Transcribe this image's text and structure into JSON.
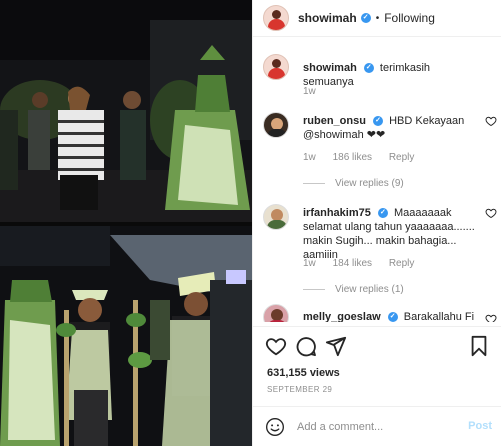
{
  "header": {
    "username": "showimah",
    "separator": "•",
    "follow_status": "Following"
  },
  "comments": [
    {
      "username": "showimah",
      "text": "terimkasih semuanya",
      "time": "1w",
      "likes": "",
      "reply": "",
      "view_replies": ""
    },
    {
      "username": "ruben_onsu",
      "text": "HBD Kekayaan @showimah ❤❤",
      "time": "1w",
      "likes": "186 likes",
      "reply": "Reply",
      "view_replies": "View replies (9)"
    },
    {
      "username": "irfanhakim75",
      "text": "Maaaaaaak selamat ulang tahun yaaaaaaa....... makin Sugih... makin bahagia... aamiiin",
      "time": "1w",
      "likes": "184 likes",
      "reply": "Reply",
      "view_replies": "View replies (1)"
    },
    {
      "username": "melly_goeslaw",
      "text": "Barakallahu Fi",
      "time": "",
      "likes": "",
      "reply": "",
      "view_replies": ""
    }
  ],
  "actions": {
    "like_icon": "heart-icon",
    "comment_icon": "comment-icon",
    "share_icon": "share-icon",
    "save_icon": "bookmark-icon"
  },
  "post": {
    "likes": "631,155 views",
    "date": "SEPTEMBER 29"
  },
  "add_comment": {
    "placeholder": "Add a comment...",
    "post_label": "Post"
  },
  "colors": {
    "verified": "#3897f0",
    "secondary_text": "#8e8e8e",
    "post_disabled": "#b2dffc"
  }
}
